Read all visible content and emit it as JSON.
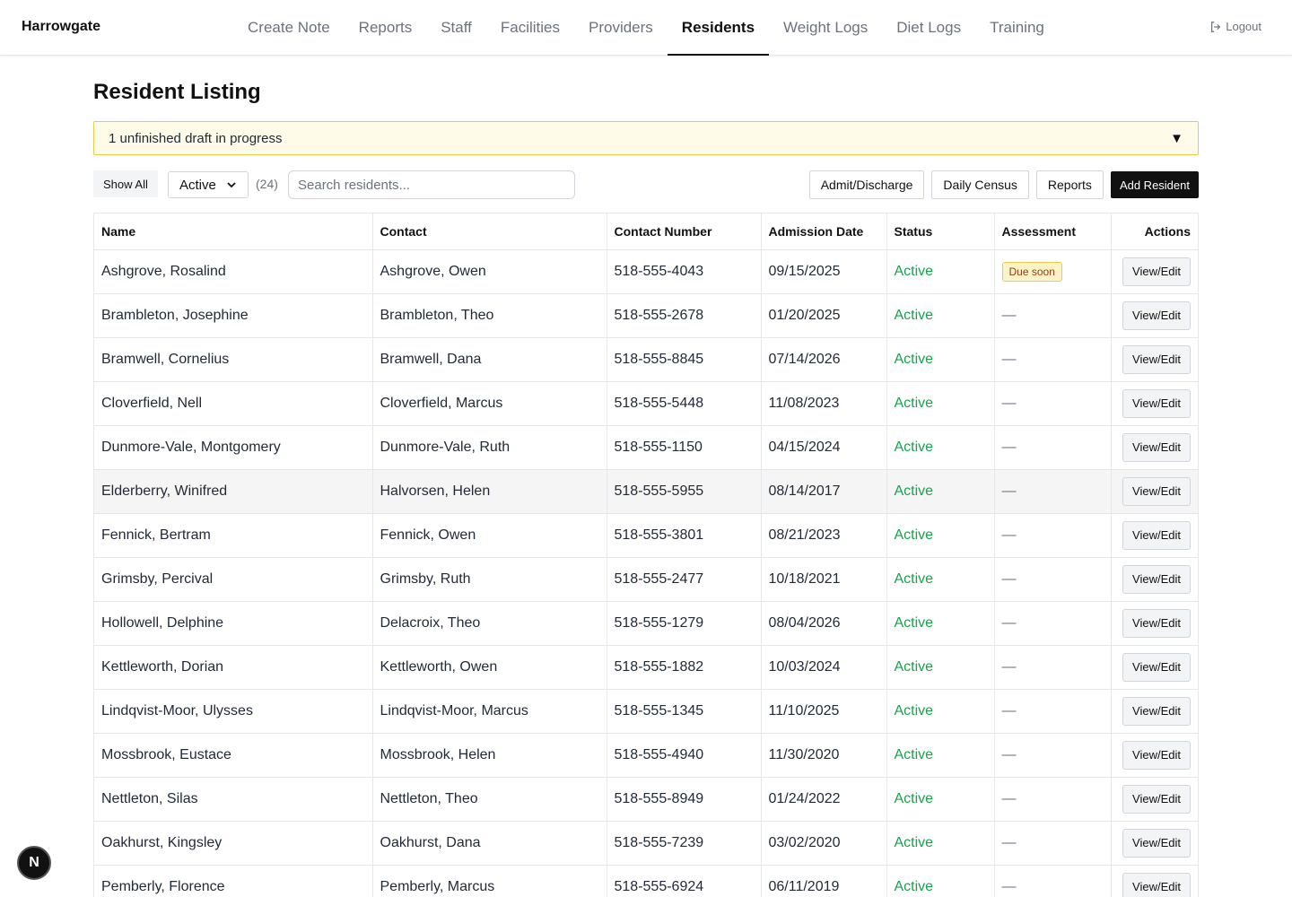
{
  "brand": "Harrowgate",
  "nav": {
    "items": [
      {
        "label": "Create Note",
        "key": "create-note"
      },
      {
        "label": "Reports",
        "key": "reports"
      },
      {
        "label": "Staff",
        "key": "staff"
      },
      {
        "label": "Facilities",
        "key": "facilities"
      },
      {
        "label": "Providers",
        "key": "providers"
      },
      {
        "label": "Residents",
        "key": "residents",
        "active": true
      },
      {
        "label": "Weight Logs",
        "key": "weight-logs"
      },
      {
        "label": "Diet Logs",
        "key": "diet-logs"
      },
      {
        "label": "Training",
        "key": "training"
      }
    ],
    "logout_label": "Logout",
    "logout_icon": "logout-icon"
  },
  "page": {
    "title": "Resident Listing",
    "draft_banner": "1 unfinished draft in progress",
    "draft_caret": "▼"
  },
  "toolbar": {
    "show_all_label": "Show All",
    "status_selected": "Active",
    "count": "(24)",
    "search_placeholder": "Search residents...",
    "admit_discharge_label": "Admit/Discharge",
    "daily_census_label": "Daily Census",
    "reports_label": "Reports",
    "add_resident_label": "Add Resident"
  },
  "table": {
    "headers": [
      "Name",
      "Contact",
      "Contact Number",
      "Admission Date",
      "Status",
      "Assessment",
      "Actions"
    ],
    "action_label": "View/Edit",
    "status_color": "#16a34a",
    "rows": [
      {
        "name": "Ashgrove, Rosalind",
        "contact": "Ashgrove, Owen",
        "phone": "518-555-4043",
        "admission": "09/15/2025",
        "status": "Active",
        "assessment": "Due soon",
        "assessment_badge": true
      },
      {
        "name": "Brambleton, Josephine",
        "contact": "Brambleton, Theo",
        "phone": "518-555-2678",
        "admission": "01/20/2025",
        "status": "Active",
        "assessment": "—"
      },
      {
        "name": "Bramwell, Cornelius",
        "contact": "Bramwell, Dana",
        "phone": "518-555-8845",
        "admission": "07/14/2026",
        "status": "Active",
        "assessment": "—"
      },
      {
        "name": "Cloverfield, Nell",
        "contact": "Cloverfield, Marcus",
        "phone": "518-555-5448",
        "admission": "11/08/2023",
        "status": "Active",
        "assessment": "—"
      },
      {
        "name": "Dunmore-Vale, Montgomery",
        "contact": "Dunmore-Vale, Ruth",
        "phone": "518-555-1150",
        "admission": "04/15/2024",
        "status": "Active",
        "assessment": "—"
      },
      {
        "name": "Elderberry, Winifred",
        "contact": "Halvorsen, Helen",
        "phone": "518-555-5955",
        "admission": "08/14/2017",
        "status": "Active",
        "assessment": "—",
        "highlighted": true
      },
      {
        "name": "Fennick, Bertram",
        "contact": "Fennick, Owen",
        "phone": "518-555-3801",
        "admission": "08/21/2023",
        "status": "Active",
        "assessment": "—"
      },
      {
        "name": "Grimsby, Percival",
        "contact": "Grimsby, Ruth",
        "phone": "518-555-2477",
        "admission": "10/18/2021",
        "status": "Active",
        "assessment": "—"
      },
      {
        "name": "Hollowell, Delphine",
        "contact": "Delacroix, Theo",
        "phone": "518-555-1279",
        "admission": "08/04/2026",
        "status": "Active",
        "assessment": "—"
      },
      {
        "name": "Kettleworth, Dorian",
        "contact": "Kettleworth, Owen",
        "phone": "518-555-1882",
        "admission": "10/03/2024",
        "status": "Active",
        "assessment": "—"
      },
      {
        "name": "Lindqvist-Moor, Ulysses",
        "contact": "Lindqvist-Moor, Marcus",
        "phone": "518-555-1345",
        "admission": "11/10/2025",
        "status": "Active",
        "assessment": "—"
      },
      {
        "name": "Mossbrook, Eustace",
        "contact": "Mossbrook, Helen",
        "phone": "518-555-4940",
        "admission": "11/30/2020",
        "status": "Active",
        "assessment": "—"
      },
      {
        "name": "Nettleton, Silas",
        "contact": "Nettleton, Theo",
        "phone": "518-555-8949",
        "admission": "01/24/2022",
        "status": "Active",
        "assessment": "—"
      },
      {
        "name": "Oakhurst, Kingsley",
        "contact": "Oakhurst, Dana",
        "phone": "518-555-7239",
        "admission": "03/02/2020",
        "status": "Active",
        "assessment": "—"
      },
      {
        "name": "Pemberly, Florence",
        "contact": "Pemberly, Marcus",
        "phone": "518-555-6924",
        "admission": "06/11/2019",
        "status": "Active",
        "assessment": "—"
      }
    ]
  },
  "floating_badge": {
    "letter": "N"
  }
}
